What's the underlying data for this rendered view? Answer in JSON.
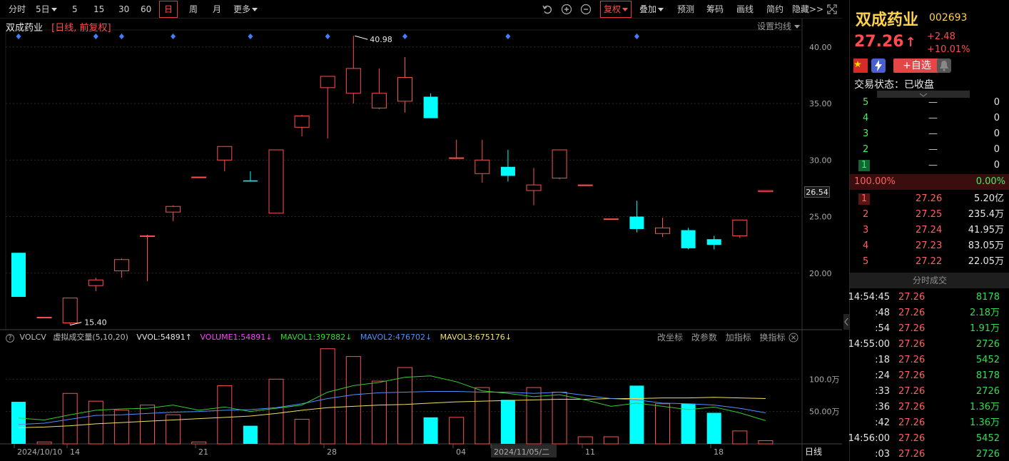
{
  "toolbar": {
    "periods": [
      "分时",
      "5日",
      "5",
      "15",
      "30",
      "60",
      "日",
      "周",
      "月",
      "更多"
    ],
    "active_period": "日",
    "right_tools": [
      "复权",
      "叠加",
      "预测",
      "筹码",
      "画线",
      "简约",
      "隐藏>>"
    ],
    "active_tool": "复权"
  },
  "chart_header": {
    "name": "双成药业",
    "mode": "[日线, 前复权]",
    "set_ma": "设置均线"
  },
  "price_axis": {
    "ticks": [
      "40.00",
      "35.00",
      "30.00",
      "25.00",
      "20.00"
    ],
    "tick_values": [
      40,
      35,
      30,
      25,
      20
    ],
    "current_tag": "26.54"
  },
  "annotations": {
    "high": "40.98",
    "low": "15.40"
  },
  "volume_header": {
    "help": "?",
    "indicator": "VOLCV",
    "desc": "虚拟成交量(5,10,20)",
    "vvol": "VVOL:54891",
    "volume1": "VOLUME1:54891",
    "mavol1": "MAVOL1:397882",
    "mavol2": "MAVOL2:476702",
    "mavol3": "MAVOL3:675176",
    "actions": [
      "改坐标",
      "改参数",
      "加指标",
      "换指标"
    ]
  },
  "volume_axis": {
    "ticks": [
      "100.0万",
      "50.00万"
    ],
    "tick_values": [
      100,
      50
    ]
  },
  "date_axis": {
    "labels": [
      "2024/10/10",
      "14",
      "21",
      "28",
      "04",
      "2024/11/05/二",
      "11",
      "18"
    ],
    "period_label": "日线"
  },
  "colors": {
    "up": "#ff5050",
    "down": "#00ffff",
    "mavol1": "#33cc33",
    "mavol2": "#4f8fff",
    "mavol3": "#f0e060"
  },
  "chart_data": {
    "type": "candlestick",
    "y_range": [
      15,
      41.5
    ],
    "candles": [
      {
        "o": 21.8,
        "c": 17.9,
        "h": 21.8,
        "l": 17.9,
        "vol": 65
      },
      {
        "o": 16.1,
        "c": 16.1,
        "h": 16.1,
        "l": 16.1,
        "vol": 3
      },
      {
        "o": 15.6,
        "c": 17.8,
        "h": 17.8,
        "l": 15.4,
        "vol": 78
      },
      {
        "o": 18.9,
        "c": 19.4,
        "h": 19.6,
        "l": 18.4,
        "vol": 66
      },
      {
        "o": 20.2,
        "c": 21.2,
        "h": 21.3,
        "l": 19.6,
        "vol": 52
      },
      {
        "o": 23.3,
        "c": 23.3,
        "h": 23.4,
        "l": 19.3,
        "vol": 60
      },
      {
        "o": 25.4,
        "c": 25.9,
        "h": 26.0,
        "l": 24.6,
        "vol": 45
      },
      {
        "o": 28.5,
        "c": 28.5,
        "h": 28.5,
        "l": 28.5,
        "vol": 3
      },
      {
        "o": 30.0,
        "c": 31.2,
        "h": 31.2,
        "l": 29.0,
        "vol": 90
      },
      {
        "o": 28.2,
        "c": 28.1,
        "h": 29.0,
        "l": 28.1,
        "vol": 28
      },
      {
        "o": 25.3,
        "c": 30.9,
        "h": 30.9,
        "l": 25.3,
        "vol": 100
      },
      {
        "o": 32.9,
        "c": 33.9,
        "h": 34.0,
        "l": 32.1,
        "vol": 38
      },
      {
        "o": 36.4,
        "c": 37.4,
        "h": 37.4,
        "l": 31.9,
        "vol": 147
      },
      {
        "o": 35.9,
        "c": 38.1,
        "h": 40.98,
        "l": 35.0,
        "vol": 135
      },
      {
        "o": 34.6,
        "c": 35.9,
        "h": 38.1,
        "l": 34.5,
        "vol": 97
      },
      {
        "o": 35.2,
        "c": 37.3,
        "h": 39.1,
        "l": 34.2,
        "vol": 118
      },
      {
        "o": 35.6,
        "c": 33.7,
        "h": 35.9,
        "l": 33.7,
        "vol": 41
      },
      {
        "o": 30.2,
        "c": 30.2,
        "h": 31.8,
        "l": 30.1,
        "vol": 41
      },
      {
        "o": 28.8,
        "c": 30.0,
        "h": 31.8,
        "l": 28.0,
        "vol": 87
      },
      {
        "o": 29.4,
        "c": 28.6,
        "h": 30.9,
        "l": 28.1,
        "vol": 68
      },
      {
        "o": 27.3,
        "c": 27.8,
        "h": 29.3,
        "l": 26.0,
        "vol": 87
      },
      {
        "o": 28.4,
        "c": 30.9,
        "h": 30.9,
        "l": 28.3,
        "vol": 80
      },
      {
        "o": 27.8,
        "c": 27.8,
        "h": 27.8,
        "l": 27.8,
        "vol": 11
      },
      {
        "o": 24.8,
        "c": 24.8,
        "h": 24.8,
        "l": 24.8,
        "vol": 11
      },
      {
        "o": 25.0,
        "c": 23.9,
        "h": 26.4,
        "l": 23.6,
        "vol": 90
      },
      {
        "o": 23.5,
        "c": 24.0,
        "h": 24.9,
        "l": 23.2,
        "vol": 62
      },
      {
        "o": 23.8,
        "c": 22.2,
        "h": 24.0,
        "l": 22.1,
        "vol": 62
      },
      {
        "o": 23.0,
        "c": 22.5,
        "h": 23.3,
        "l": 22.1,
        "vol": 48
      },
      {
        "o": 23.3,
        "c": 24.7,
        "h": 24.7,
        "l": 23.1,
        "vol": 20
      },
      {
        "o": 27.2,
        "c": 27.3,
        "h": 27.3,
        "l": 27.2,
        "vol": 5
      }
    ],
    "mavol1": [
      40,
      37,
      45,
      52,
      54,
      55,
      60,
      52,
      57,
      50,
      55,
      60,
      80,
      90,
      95,
      103,
      105,
      96,
      82,
      78,
      73,
      76,
      68,
      58,
      63,
      58,
      53,
      57,
      48,
      36
    ],
    "mavol2": [
      30,
      32,
      38,
      44,
      45,
      47,
      49,
      50,
      52,
      53,
      56,
      62,
      70,
      76,
      79,
      80,
      81,
      81,
      80,
      80,
      78,
      80,
      75,
      70,
      68,
      63,
      62,
      60,
      55,
      48
    ],
    "mavol3": [
      25,
      26,
      28,
      31,
      33,
      35,
      37,
      39,
      41,
      43,
      47,
      52,
      56,
      58,
      60,
      61,
      63,
      65,
      66,
      67,
      68,
      69,
      69,
      70,
      70,
      71,
      71,
      72,
      71,
      70
    ],
    "vol_range": [
      0,
      150
    ]
  },
  "quote": {
    "name": "双成药业",
    "code": "002693",
    "price": "27.26",
    "arrow": "↑",
    "change": "+2.48",
    "change_pct": "+10.01%",
    "add_watch": "+自选",
    "status_label": "交易状态：已收盘"
  },
  "asks": [
    {
      "level": "5",
      "price": "—",
      "vol": "0"
    },
    {
      "level": "4",
      "price": "—",
      "vol": "0"
    },
    {
      "level": "3",
      "price": "—",
      "vol": "0"
    },
    {
      "level": "2",
      "price": "—",
      "vol": "0"
    },
    {
      "level": "1",
      "price": "—",
      "vol": "0"
    }
  ],
  "ratio": {
    "left": "100.00%",
    "right": "0.00%"
  },
  "bids": [
    {
      "level": "1",
      "price": "27.26",
      "vol": "5.20亿"
    },
    {
      "level": "2",
      "price": "27.25",
      "vol": "235.4万"
    },
    {
      "level": "3",
      "price": "27.24",
      "vol": "41.95万"
    },
    {
      "level": "4",
      "price": "27.23",
      "vol": "83.05万"
    },
    {
      "level": "5",
      "price": "27.22",
      "vol": "22.05万"
    }
  ],
  "ticks_title": "分时成交",
  "ticks": [
    {
      "time": "14:54:45",
      "price": "27.26",
      "vol": "8178"
    },
    {
      "time": ":48",
      "price": "27.26",
      "vol": "2.18万"
    },
    {
      "time": ":54",
      "price": "27.26",
      "vol": "1.91万"
    },
    {
      "time": "14:55:00",
      "price": "27.26",
      "vol": "2726"
    },
    {
      "time": ":18",
      "price": "27.26",
      "vol": "5452"
    },
    {
      "time": ":24",
      "price": "27.26",
      "vol": "8178"
    },
    {
      "time": ":33",
      "price": "27.26",
      "vol": "2726"
    },
    {
      "time": ":36",
      "price": "27.26",
      "vol": "1.36万"
    },
    {
      "time": ":42",
      "price": "27.26",
      "vol": "1.36万"
    },
    {
      "time": "14:56:00",
      "price": "27.26",
      "vol": "5452"
    },
    {
      "time": ":03",
      "price": "27.26",
      "vol": "2726"
    }
  ]
}
